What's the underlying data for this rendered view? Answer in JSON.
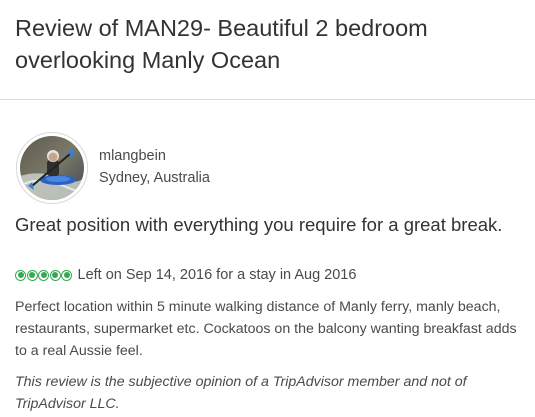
{
  "page": {
    "title": "Review of MAN29- Beautiful 2 bedroom overlooking Manly Ocean"
  },
  "reviewer": {
    "username": "mlangbein",
    "location": "Sydney, Australia",
    "avatar_icon": "kayaker-photo-avatar"
  },
  "review": {
    "title": "Great position with everything you require for a great break.",
    "rating": 5,
    "rating_max": 5,
    "rating_color": "#34a853",
    "date_text": "Left on Sep 14, 2016 for a stay in Aug 2016",
    "body": "Perfect location within 5 minute walking distance of Manly ferry, manly beach, restaurants, supermarket etc. Cockatoos on the balcony wanting breakfast adds to a real Aussie feel.",
    "disclaimer": "This review is the subjective opinion of a TripAdvisor member and not of TripAdvisor LLC."
  }
}
